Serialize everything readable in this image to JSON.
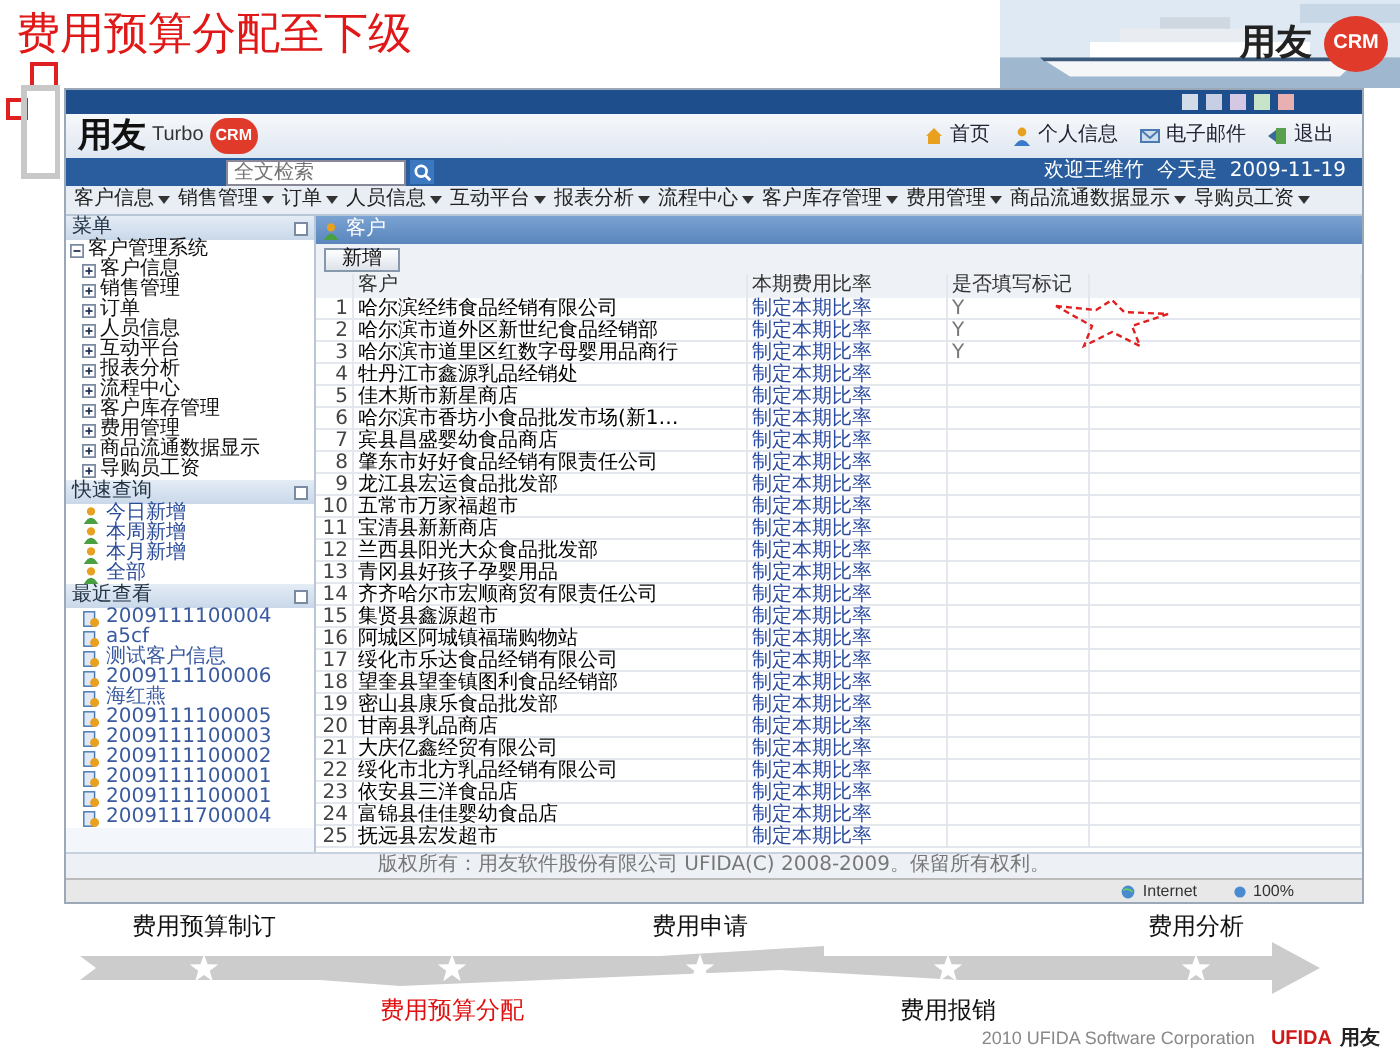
{
  "slide": {
    "title": "费用预算分配至下级",
    "banner_logo": "用友",
    "banner_badge": "CRM",
    "footer": "2010 UFIDA Software Corporation",
    "footer_brand": "UFIDA",
    "footer_brand_cn": "用友"
  },
  "app": {
    "logo": "用友",
    "logo_product": "Turbo",
    "logo_badge": "CRM",
    "nav": [
      "首页",
      "个人信息",
      "电子邮件",
      "退出"
    ],
    "search": {
      "placeholder": "全文检索"
    },
    "welcome": "欢迎王维竹  今天是  2009-11-19",
    "menu": [
      "客户信息",
      "销售管理",
      "订单",
      "人员信息",
      "互动平台",
      "报表分析",
      "流程中心",
      "客户库存管理",
      "费用管理",
      "商品流通数据显示",
      "导购员工资"
    ],
    "sidebar": {
      "menu_title": "菜单",
      "tree": {
        "label": "客户管理系统",
        "expanded": true,
        "children": [
          {
            "label": "客户信息",
            "expanded": false
          },
          {
            "label": "销售管理",
            "expanded": false
          },
          {
            "label": "订单",
            "expanded": false
          },
          {
            "label": "人员信息",
            "expanded": false
          },
          {
            "label": "互动平台",
            "expanded": false
          },
          {
            "label": "报表分析",
            "expanded": false
          },
          {
            "label": "流程中心",
            "expanded": false
          },
          {
            "label": "客户库存管理",
            "expanded": false
          },
          {
            "label": "费用管理",
            "expanded": false
          },
          {
            "label": "商品流通数据显示",
            "expanded": false
          },
          {
            "label": "导购员工资",
            "expanded": false
          }
        ]
      },
      "quick_title": "快速查询",
      "quick": [
        "今日新增",
        "本周新增",
        "本月新增",
        "全部"
      ],
      "recent_title": "最近查看",
      "recent": [
        "2009111100004",
        "a5cf",
        "测试客户信息",
        "2009111100006",
        "海红燕",
        "2009111100005",
        "2009111100003",
        "2009111100002",
        "2009111100001",
        "2009111100001",
        "2009111700004"
      ]
    },
    "panel_title": "客户",
    "new_button": "新增",
    "table": {
      "columns": [
        "客户",
        "本期费用比率",
        "是否填写标记"
      ],
      "rows": [
        {
          "no": "1",
          "customer": "哈尔滨经纬食品经销有限公司",
          "rate": "制定本期比率",
          "filled": "Y"
        },
        {
          "no": "2",
          "customer": "哈尔滨市道外区新世纪食品经销部",
          "rate": "制定本期比率",
          "filled": "Y"
        },
        {
          "no": "3",
          "customer": "哈尔滨市道里区红数字母婴用品商行",
          "rate": "制定本期比率",
          "filled": "Y"
        },
        {
          "no": "4",
          "customer": "牡丹江市鑫源乳品经销处",
          "rate": "制定本期比率"
        },
        {
          "no": "5",
          "customer": "佳木斯市新星商店",
          "rate": "制定本期比率"
        },
        {
          "no": "6",
          "customer": "哈尔滨市香坊小食品批发市场(新1…",
          "rate": "制定本期比率"
        },
        {
          "no": "7",
          "customer": "宾县昌盛婴幼食品商店",
          "rate": "制定本期比率"
        },
        {
          "no": "8",
          "customer": "肇东市好好食品经销有限责任公司",
          "rate": "制定本期比率"
        },
        {
          "no": "9",
          "customer": "龙江县宏运食品批发部",
          "rate": "制定本期比率"
        },
        {
          "no": "10",
          "customer": "五常市万家福超市",
          "rate": "制定本期比率"
        },
        {
          "no": "11",
          "customer": "宝清县新新商店",
          "rate": "制定本期比率"
        },
        {
          "no": "12",
          "customer": "兰西县阳光大众食品批发部",
          "rate": "制定本期比率"
        },
        {
          "no": "13",
          "customer": "青冈县好孩子孕婴用品",
          "rate": "制定本期比率"
        },
        {
          "no": "14",
          "customer": "齐齐哈尔市宏顺商贸有限责任公司",
          "rate": "制定本期比率"
        },
        {
          "no": "15",
          "customer": "集贤县鑫源超市",
          "rate": "制定本期比率"
        },
        {
          "no": "16",
          "customer": "阿城区阿城镇福瑞购物站",
          "rate": "制定本期比率"
        },
        {
          "no": "17",
          "customer": "绥化市乐达食品经销有限公司",
          "rate": "制定本期比率"
        },
        {
          "no": "18",
          "customer": "望奎县望奎镇图利食品经销部",
          "rate": "制定本期比率"
        },
        {
          "no": "19",
          "customer": "密山县康乐食品批发部",
          "rate": "制定本期比率"
        },
        {
          "no": "20",
          "customer": "甘南县乳品商店",
          "rate": "制定本期比率"
        },
        {
          "no": "21",
          "customer": "大庆亿鑫经贸有限公司",
          "rate": "制定本期比率"
        },
        {
          "no": "22",
          "customer": "绥化市北方乳品经销有限公司",
          "rate": "制定本期比率"
        },
        {
          "no": "23",
          "customer": "依安县三洋食品店",
          "rate": "制定本期比率"
        },
        {
          "no": "24",
          "customer": "富锦县佳佳婴幼食品店",
          "rate": "制定本期比率"
        },
        {
          "no": "25",
          "customer": "抚远县宏发超市",
          "rate": "制定本期比率"
        }
      ]
    },
    "footer": "版权所有：用友软件股份有限公司 UFIDA(C) 2008-2009。保留所有权利。",
    "status": {
      "zone": "Internet",
      "zoom": "100%"
    }
  },
  "timeline": [
    {
      "label": "费用预算制订",
      "selected": false
    },
    {
      "label": "费用预算分配",
      "selected": true
    },
    {
      "label": "费用申请",
      "selected": false
    },
    {
      "label": "费用报销",
      "selected": false
    },
    {
      "label": "费用分析",
      "selected": false
    }
  ]
}
